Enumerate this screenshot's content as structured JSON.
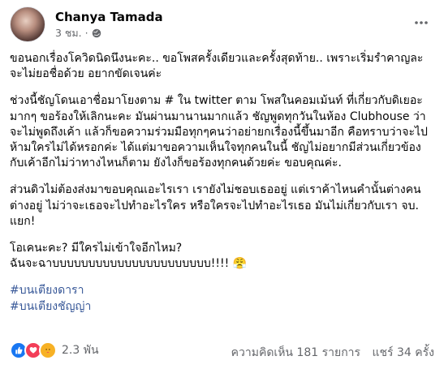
{
  "author": {
    "name": "Chanya Tamada"
  },
  "timestamp": "3 ชม.",
  "dot": "·",
  "paragraphs": [
    "ขอนอกเรื่องโควิดนิดนึงนะคะ.. ขอโพสครั้งเดียวและครั้งสุดท้าย.. เพราะเริ่มรำคาญละ จะไม่ยอชื่อด้วย อยากขัดเจนค่ะ",
    "ช่วงนี้ชัญโดนเอาชื่อมาโยงตาม # ใน twitter ตาม โพสในคอมเม้นท์ ที่เกี่ยวกับดิเยอะมากๆ ขอร้องให้เลิกนะคะ มันผ่านมานานมากแล้ว ชัญพูดทุกวันในห้อง Clubhouse ว่าจะไม่พูดถึงเค้า แล้วก็ขอความร่วมมือทุกๆคนว่าอย่ายกเรื่องนี้ขึ้นมาอีก คือทราบว่าจะไปห้ามใครไม่ได้หรอกค่ะ ได้แต่มาขอความเห็นใจทุกคนในนี้ ชัญไม่อยากมีส่วนเกี่ยวข้องกับเค้าอีกไม่ว่าทางไหนก็ตาม ยังไงก็ขอร้องทุกคนด้วยค่ะ ขอบคุณค่ะ.",
    "ส่วนดิวไม่ต้องส่งมาขอบคุณเอะไรเรา เรายังไม่ชอบเธออยู่ แต่เราค้าไหนคำนั้นต่างคนต่างอยู่ ไม่ว่าจะเธอจะไปทำอะไรใคร หรือใครจะไปทำอะไรเธอ มันไม่เกี่ยวกับเรา จบ. แยก!",
    "โอเคนะคะ? มีใครไม่เข้าใจอีกไหม?\nฉันจะฉาบบบบบบบบบบบบบบบบบบบบบบ!!!! 😤"
  ],
  "hashtags": [
    "#บนเตียงดารา",
    "#บนเตียงชัญญ่า"
  ],
  "reactions": {
    "count": "2.3 พัน",
    "types": [
      "like-icon",
      "love-icon",
      "care-icon"
    ]
  },
  "comments": "ความคิดเห็น 181 รายการ",
  "shares": "แชร์ 34 ครั้ง",
  "colors": {
    "link": "#385898",
    "muted": "#65676b"
  }
}
